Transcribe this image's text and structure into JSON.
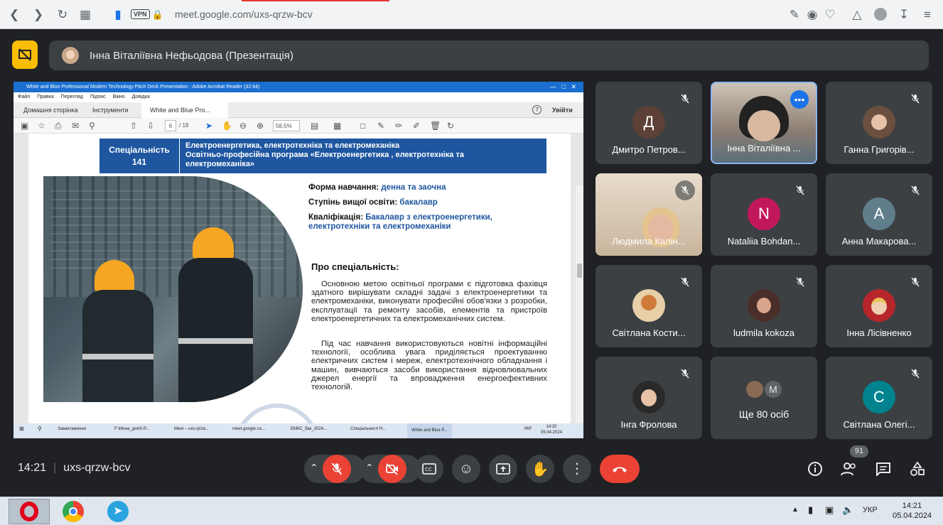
{
  "browser": {
    "url_host": "meet.google.com/",
    "url_path": "uxs-qrzw-bcv",
    "vpn": "VPN"
  },
  "header": {
    "title": "Інна Віталіївна Нефьодова (Презентація)"
  },
  "acrobat": {
    "title": "White and Blue Professional Modern Technology Pitch Deck Presentation - Adobe Acrobat Reader (32-bit)",
    "menu": [
      "Файл",
      "Правка",
      "Перегляд",
      "Підпис",
      "Вікно",
      "Довідка"
    ],
    "tabs": [
      "Домашня сторінка",
      "Інструменти",
      "White and Blue Pro..."
    ],
    "signin": "Увійти",
    "page_current": "6",
    "page_total": "/ 18",
    "zoom": "58,5%"
  },
  "slide": {
    "spec_label": "Спеціальність",
    "spec_code": "141",
    "head_line1": "Електроенергетика, електротехніка та електромеханіка",
    "head_line2": "Освітньо-професійна програма «Електроенергетика , електротехніка та",
    "head_line3": "електромеханіка»",
    "form_label": "Форма навчання:",
    "form_value": "денна та заочна",
    "degree_label": "Ступінь вищої освіти:",
    "degree_value": "бакалавр",
    "qual_label": "Кваліфікація:",
    "qual_value1": "Бакалавр з електроенергетики,",
    "qual_value2": "електротехніки та електромеханіки",
    "about_title": "Про спеціальність:",
    "para1": "Основною метою освітньої програми є підготовка фахівця здатного вирішувати складні задачі з електроенергетики та електромеханіки, виконувати професійні обов'язки з розробки, експлуатації та ремонту засобів, елементів та пристроїв електроенергетичних та електромеханічних систем.",
    "para2": "Під час навчання використовуються новітні інформаційні технології, особлива увага приділяється проектуванню електричних систем і мереж, електротехнічного обладнання і машин, вивчаються засоби використання відновлювальних джерел енергії та впровадження енергоефективних технологій."
  },
  "inner_taskbar": {
    "items": [
      "Завантаження",
      "F:\\Инна_док\\0-Р...",
      "Meet – uxs-qrzw...",
      "meet.google.co...",
      "ЕМКС_бак_2024...",
      "Спеціальності Н...",
      "White and Blue P..."
    ],
    "lang": "УКР",
    "time": "14:20",
    "date": "05.04.2024"
  },
  "participants": [
    {
      "name": "Дмитро Петров...",
      "initial": "Д",
      "color": "#5d4037"
    },
    {
      "name": "Інна Віталіївна ...",
      "initial": "",
      "color": ""
    },
    {
      "name": "Ганна Григорів...",
      "initial": "",
      "color": ""
    },
    {
      "name": "Людмила Калін...",
      "initial": "",
      "color": ""
    },
    {
      "name": "Nataliia Bohdan...",
      "initial": "N",
      "color": "#c2185b"
    },
    {
      "name": "Анна Макарова...",
      "initial": "А",
      "color": "#607d8b"
    },
    {
      "name": "Світлана Кости...",
      "initial": "",
      "color": ""
    },
    {
      "name": "ludmila kokoza",
      "initial": "",
      "color": ""
    },
    {
      "name": "Інна Лісівненко",
      "initial": "",
      "color": ""
    },
    {
      "name": "Інга Фролова",
      "initial": "",
      "color": ""
    },
    {
      "name": "Ще 80 осіб",
      "initial": "M",
      "color": "#5f6368"
    },
    {
      "name": "Світлана Олегі...",
      "initial": "С",
      "color": "#00838f"
    }
  ],
  "bottom": {
    "time": "14:21",
    "code": "uxs-qrzw-bcv",
    "people_count": "91"
  },
  "win_taskbar": {
    "lang": "УКР",
    "time": "14:21",
    "date": "05.04.2024"
  }
}
